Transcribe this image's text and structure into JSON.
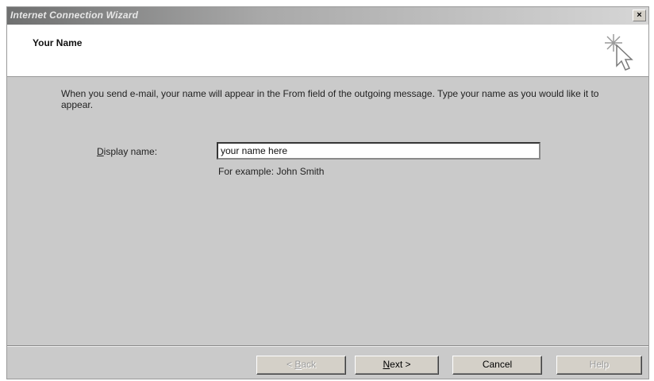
{
  "window": {
    "title": "Internet Connection Wizard",
    "close_label": "×"
  },
  "header": {
    "title": "Your Name",
    "icon": "wizard-cursor-sparkle-icon"
  },
  "content": {
    "description": "When you send e-mail, your name will appear in the From field of the outgoing message. Type your name as you would like it to appear.",
    "display_name_label_accel": "D",
    "display_name_label_rest": "isplay name:",
    "display_name_value": "your name here",
    "example_text": "For example: John Smith"
  },
  "buttons": {
    "back_accel": "B",
    "back_pre": "< ",
    "back_rest": "ack",
    "next_accel": "N",
    "next_rest": "ext >",
    "cancel": "Cancel",
    "help": "Help"
  }
}
